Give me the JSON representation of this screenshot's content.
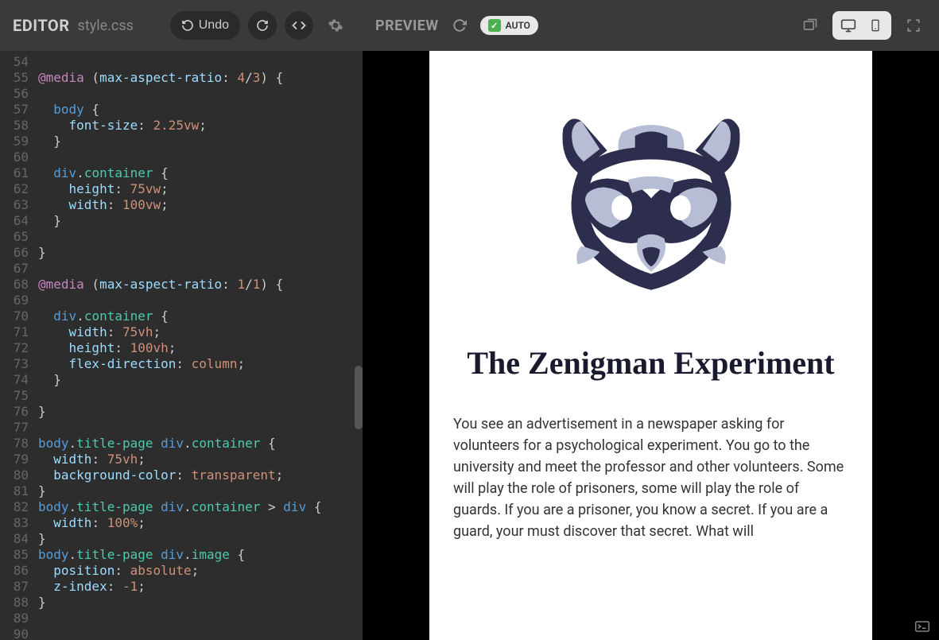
{
  "editor": {
    "title": "EDITOR",
    "filename": "style.css",
    "undo_label": "Undo",
    "line_start": 54,
    "line_end": 90,
    "code": [
      "",
      "@media (max-aspect-ratio: 4/3) {",
      "",
      "  body {",
      "    font-size: 2.25vw;",
      "  }",
      "",
      "  div.container {",
      "    height: 75vw;",
      "    width: 100vw;",
      "  }",
      "",
      "}",
      "",
      "@media (max-aspect-ratio: 1/1) {",
      "",
      "  div.container {",
      "    width: 75vh;",
      "    height: 100vh;",
      "    flex-direction: column;",
      "  }",
      "",
      "}",
      "",
      "body.title-page div.container {",
      "  width: 75vh;",
      "  background-color: transparent;",
      "}",
      "body.title-page div.container > div {",
      "  width: 100%;",
      "}",
      "body.title-page div.image {",
      "  position: absolute;",
      "  z-index: -1;",
      "}",
      "",
      ""
    ]
  },
  "preview": {
    "title": "PREVIEW",
    "auto_label": "AUTO",
    "page": {
      "heading": "The Zenigman Experiment",
      "body": "You see an advertisement in a newspaper asking for volunteers for a psychological experiment. You go to the university and meet the professor and other volunteers. Some will play the role of prisoners, some will play the role of guards. If you are a prisoner, you know a secret. If you are a guard, your must discover that secret. What will"
    }
  }
}
